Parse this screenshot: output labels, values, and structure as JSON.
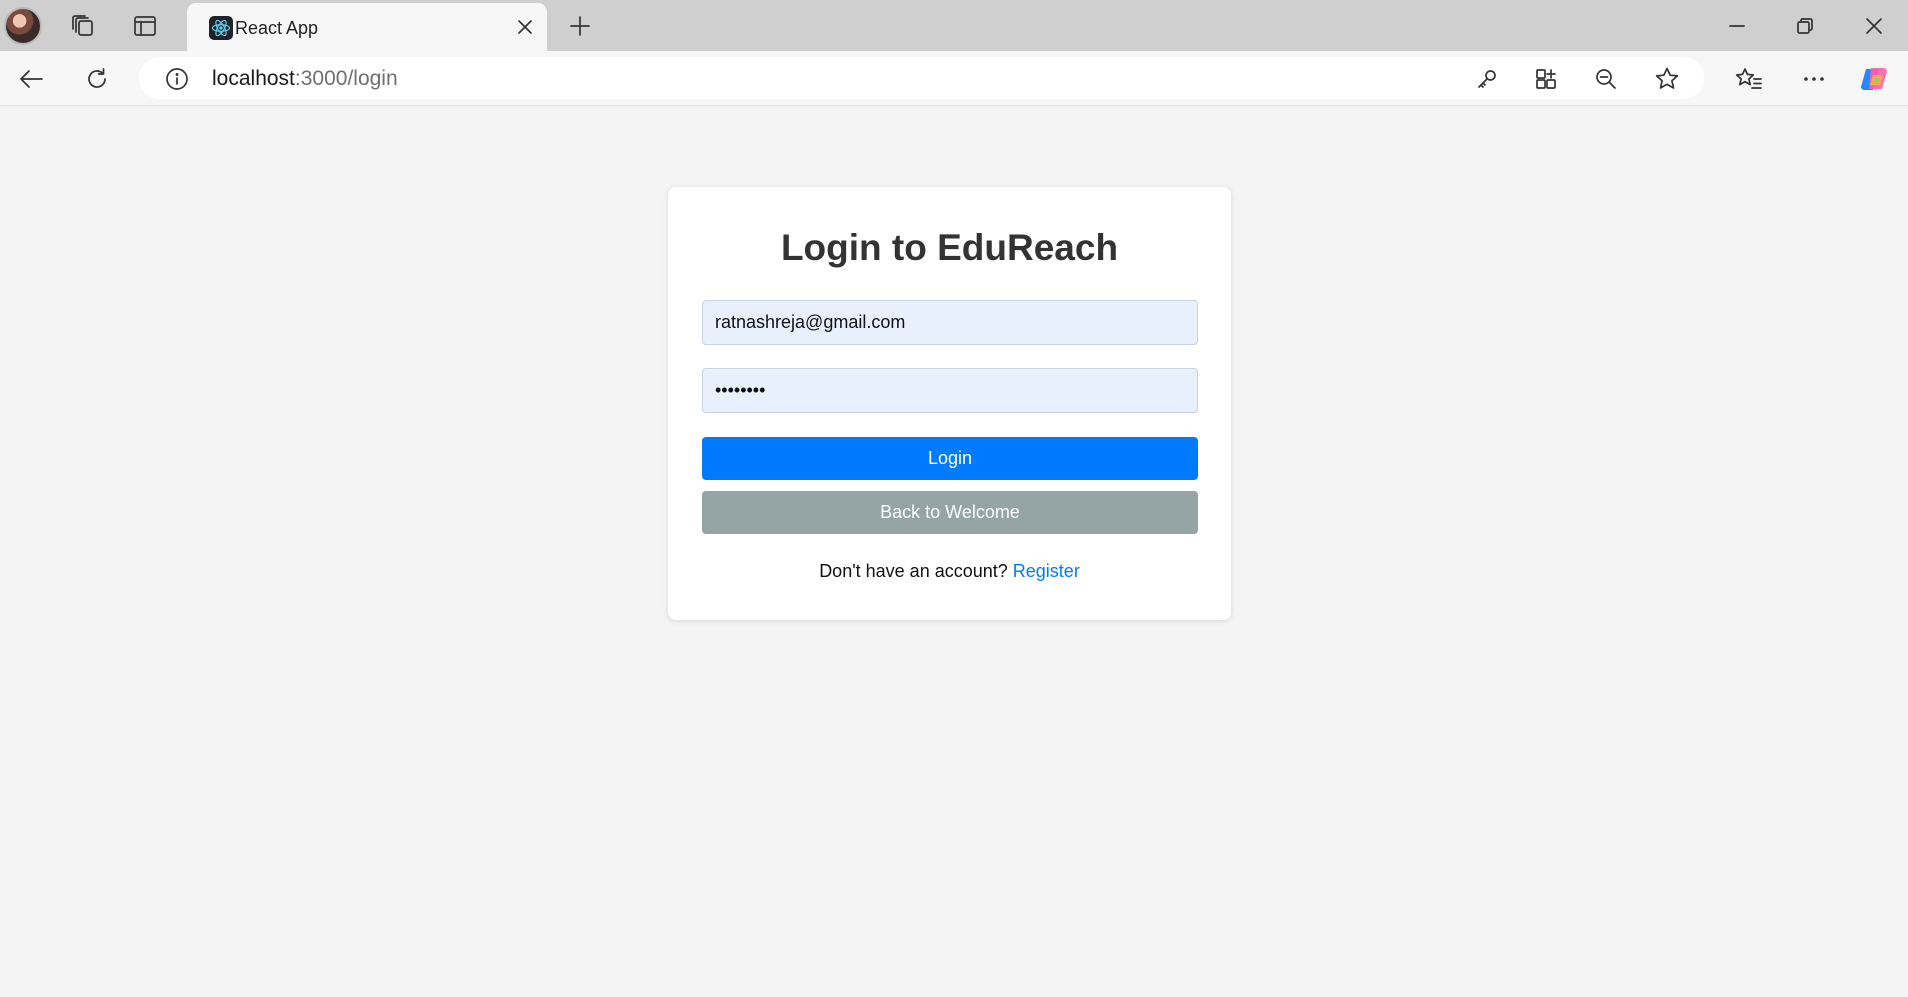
{
  "browser": {
    "tab": {
      "title": "React App",
      "favicon": "react-icon"
    },
    "address": {
      "host": "localhost",
      "path": ":3000/login"
    },
    "icons": {
      "profile": "avatar",
      "workspaces": "workspaces-icon",
      "tab_actions": "vertical-tabs-icon",
      "close_tab": "close-icon",
      "new_tab": "plus-icon",
      "minimize": "minimize-icon",
      "restore": "restore-icon",
      "close_window": "close-icon",
      "back": "back-arrow-icon",
      "refresh": "refresh-icon",
      "site_info": "info-icon",
      "password": "key-icon",
      "apps": "apps-icon",
      "zoom": "zoom-out-icon",
      "favorite": "star-icon",
      "favorites": "favorites-icon",
      "more": "more-icon",
      "copilot": "copilot-icon"
    }
  },
  "login": {
    "title": "Login to EduReach",
    "email_value": "ratnashreja@gmail.com",
    "password_value": "ratnashr",
    "login_label": "Login",
    "back_label": "Back to Welcome",
    "no_account_text": "Don't have an account?",
    "register_link": "Register"
  },
  "colors": {
    "primary": "#007bff",
    "secondary": "#95a5a6",
    "link": "#007bff",
    "field_bg": "#e8f0fe",
    "page_bg": "#f4f4f4",
    "card_bg": "#ffffff"
  }
}
